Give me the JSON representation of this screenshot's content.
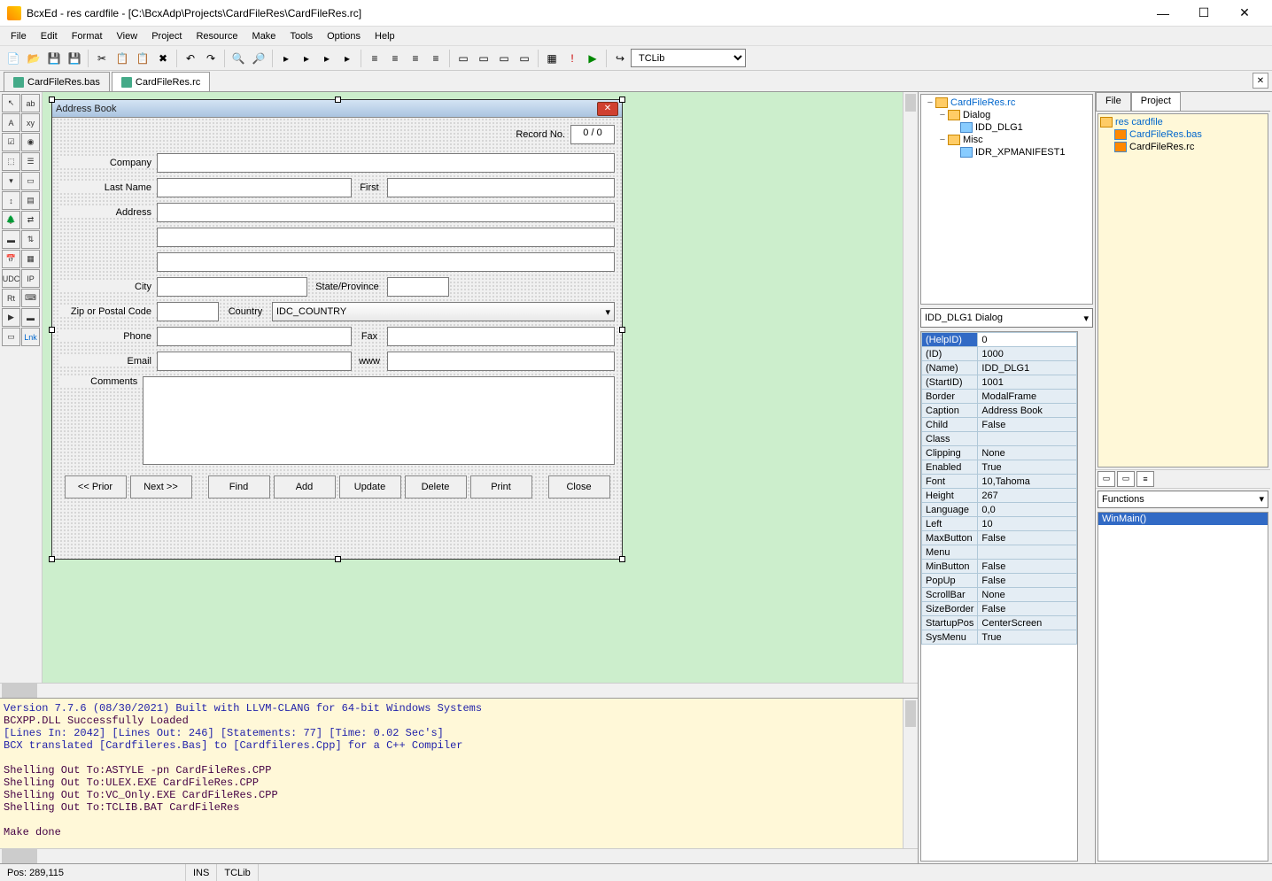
{
  "window": {
    "title": "BcxEd - res cardfile - [C:\\BcxAdp\\Projects\\CardFileRes\\CardFileRes.rc]"
  },
  "menus": [
    "File",
    "Edit",
    "Format",
    "View",
    "Project",
    "Resource",
    "Make",
    "Tools",
    "Options",
    "Help"
  ],
  "toolbar_combo": "TCLib",
  "editor_tabs": [
    {
      "label": "CardFileRes.bas",
      "active": false
    },
    {
      "label": "CardFileRes.rc",
      "active": true
    }
  ],
  "dialog": {
    "caption": "Address Book",
    "record_label": "Record No.",
    "record_value": "0 / 0",
    "labels": {
      "company": "Company",
      "lastname": "Last Name",
      "first": "First",
      "address": "Address",
      "city": "City",
      "state": "State/Province",
      "zip": "Zip or Postal Code",
      "country": "Country",
      "country_combo": "IDC_COUNTRY",
      "phone": "Phone",
      "fax": "Fax",
      "email": "Email",
      "www": "www",
      "comments": "Comments"
    },
    "buttons": {
      "prior": "<<  Prior",
      "next": "Next  >>",
      "find": "Find",
      "add": "Add",
      "update": "Update",
      "delete": "Delete",
      "print": "Print",
      "close": "Close"
    }
  },
  "resource_tree": {
    "root": "CardFileRes.rc",
    "dialog_folder": "Dialog",
    "dialog_item": "IDD_DLG1",
    "misc_folder": "Misc",
    "misc_item": "IDR_XPMANIFEST1"
  },
  "prop_selector": "IDD_DLG1 Dialog",
  "properties": [
    {
      "k": "(HelpID)",
      "v": "0",
      "sel": true
    },
    {
      "k": "(ID)",
      "v": "1000"
    },
    {
      "k": "(Name)",
      "v": "IDD_DLG1"
    },
    {
      "k": "(StartID)",
      "v": "1001"
    },
    {
      "k": "Border",
      "v": "ModalFrame"
    },
    {
      "k": "Caption",
      "v": "Address Book"
    },
    {
      "k": "Child",
      "v": "False"
    },
    {
      "k": "Class",
      "v": ""
    },
    {
      "k": "Clipping",
      "v": "None"
    },
    {
      "k": "Enabled",
      "v": "True"
    },
    {
      "k": "Font",
      "v": "10,Tahoma"
    },
    {
      "k": "Height",
      "v": "267"
    },
    {
      "k": "Language",
      "v": "0,0"
    },
    {
      "k": "Left",
      "v": "10"
    },
    {
      "k": "MaxButton",
      "v": "False"
    },
    {
      "k": "Menu",
      "v": ""
    },
    {
      "k": "MinButton",
      "v": "False"
    },
    {
      "k": "PopUp",
      "v": "False"
    },
    {
      "k": "ScrollBar",
      "v": "None"
    },
    {
      "k": "SizeBorder",
      "v": "False"
    },
    {
      "k": "StartupPos",
      "v": "CenterScreen"
    },
    {
      "k": "SysMenu",
      "v": "True"
    }
  ],
  "project_tabs": {
    "file": "File",
    "project": "Project"
  },
  "project_tree": {
    "root": "res cardfile",
    "items": [
      "CardFileRes.bas",
      "CardFileRes.rc"
    ]
  },
  "functions_label": "Functions",
  "functions": [
    "WinMain()"
  ],
  "output_lines": [
    {
      "t": "Version 7.7.6 (08/30/2021) Built with LLVM-CLANG for 64-bit Windows Systems",
      "c": "blue"
    },
    {
      "t": "BCXPP.DLL Successfully Loaded",
      "c": ""
    },
    {
      "t": "[Lines In: 2042] [Lines Out: 246] [Statements: 77] [Time: 0.02 Sec's]",
      "c": "blue"
    },
    {
      "t": "BCX translated [Cardfileres.Bas] to [Cardfileres.Cpp] for a C++ Compiler",
      "c": "blue"
    },
    {
      "t": "",
      "c": ""
    },
    {
      "t": "Shelling Out To:ASTYLE -pn CardFileRes.CPP",
      "c": ""
    },
    {
      "t": "Shelling Out To:ULEX.EXE CardFileRes.CPP",
      "c": ""
    },
    {
      "t": "Shelling Out To:VC_Only.EXE CardFileRes.CPP",
      "c": ""
    },
    {
      "t": "Shelling Out To:TCLIB.BAT CardFileRes",
      "c": ""
    },
    {
      "t": "",
      "c": ""
    },
    {
      "t": "Make done",
      "c": ""
    }
  ],
  "status": {
    "pos": "Pos: 289,115",
    "ins": "INS",
    "lib": "TCLib"
  }
}
